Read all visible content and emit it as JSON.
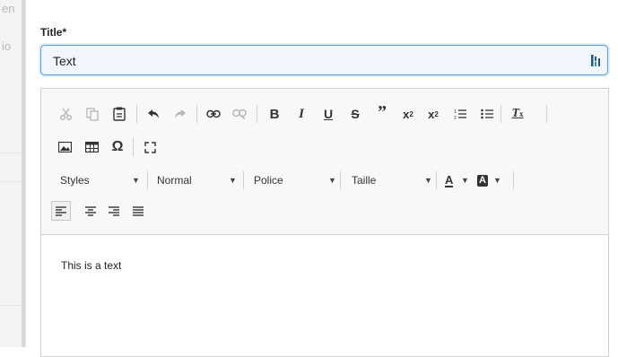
{
  "background": {
    "fragment_top": "en",
    "fragment_mid": "io"
  },
  "field": {
    "label": "Title*",
    "value": "Text",
    "extension_icon": "grammar-extension-icon"
  },
  "toolbar": {
    "row1": [
      "cut-icon",
      "copy-icon",
      "paste-icon",
      "undo-icon",
      "redo-icon",
      "link-icon",
      "unlink-icon",
      "bold-icon",
      "italic-icon",
      "underline-icon",
      "strike-icon",
      "blockquote-icon",
      "subscript-icon",
      "superscript-icon",
      "numbered-list-icon",
      "bullet-list-icon",
      "remove-format-icon"
    ],
    "row2": [
      "image-icon",
      "table-icon",
      "special-char-icon",
      "maximize-icon"
    ],
    "styles_label": "Styles",
    "format_label": "Normal",
    "font_label": "Police",
    "size_label": "Taille",
    "text_color_glyph": "A",
    "bg_color_glyph": "A",
    "row4": [
      "align-left-icon",
      "align-center-icon",
      "align-right-icon",
      "justify-icon"
    ]
  },
  "editor_content": "This is a text",
  "colors": {
    "focus_border": "#5b9ad6",
    "toolbar_bg": "#f8f8f8",
    "input_bg": "#f0f6fc"
  }
}
